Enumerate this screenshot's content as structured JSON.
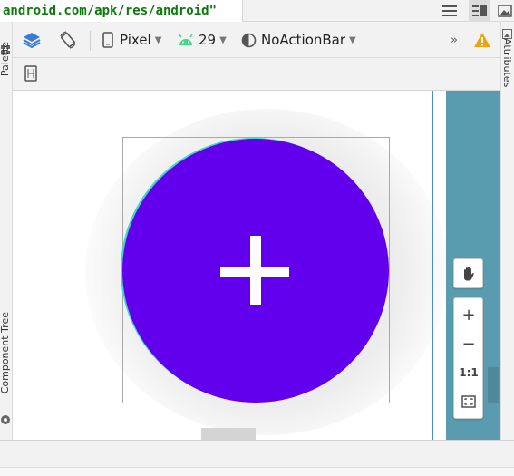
{
  "editor": {
    "xml_snippet": "android.com/apk/res/android\""
  },
  "side_tabs": {
    "palette": "Palette",
    "component_tree": "Component Tree",
    "attributes": "Attributes"
  },
  "toolbar": {
    "device": "Pixel",
    "api_level": "29",
    "theme": "NoActionBar",
    "overflow": "»"
  },
  "zoom_controls": {
    "zoom_in": "+",
    "zoom_out": "−",
    "actual_size": "1:1"
  },
  "colors": {
    "fab": "#6200ee",
    "fab_edge": "#3fd5c8",
    "warning": "#f0a30a",
    "android_green": "#3ddc84",
    "device_panel": "#5a9caf"
  }
}
